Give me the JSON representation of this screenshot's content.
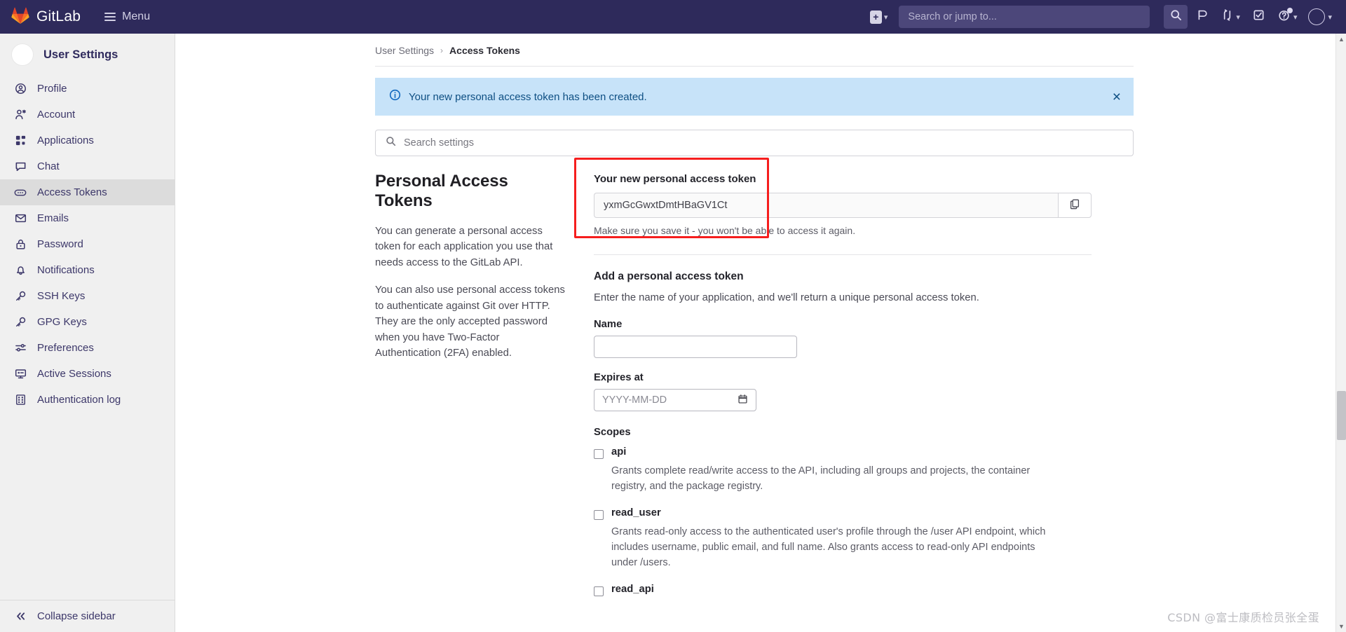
{
  "topnav": {
    "brand": "GitLab",
    "menu_label": "Menu",
    "new_icon": "plus-square-icon",
    "search_placeholder": "Search or jump to...",
    "icons": [
      {
        "name": "search-icon",
        "label": ""
      },
      {
        "name": "issues-icon",
        "label": ""
      },
      {
        "name": "merge-requests-icon",
        "label": ""
      },
      {
        "name": "todos-icon",
        "label": ""
      },
      {
        "name": "help-icon",
        "label": ""
      },
      {
        "name": "user-avatar-icon",
        "label": ""
      }
    ]
  },
  "sidebar": {
    "title": "User Settings",
    "items": [
      {
        "label": "Profile",
        "icon": "profile-icon",
        "active": false
      },
      {
        "label": "Account",
        "icon": "account-icon",
        "active": false
      },
      {
        "label": "Applications",
        "icon": "applications-icon",
        "active": false
      },
      {
        "label": "Chat",
        "icon": "chat-icon",
        "active": false
      },
      {
        "label": "Access Tokens",
        "icon": "token-icon",
        "active": true
      },
      {
        "label": "Emails",
        "icon": "email-icon",
        "active": false
      },
      {
        "label": "Password",
        "icon": "lock-icon",
        "active": false
      },
      {
        "label": "Notifications",
        "icon": "bell-icon",
        "active": false
      },
      {
        "label": "SSH Keys",
        "icon": "key-icon",
        "active": false
      },
      {
        "label": "GPG Keys",
        "icon": "key-icon",
        "active": false
      },
      {
        "label": "Preferences",
        "icon": "sliders-icon",
        "active": false
      },
      {
        "label": "Active Sessions",
        "icon": "monitor-icon",
        "active": false
      },
      {
        "label": "Authentication log",
        "icon": "log-icon",
        "active": false
      }
    ],
    "collapse_label": "Collapse sidebar",
    "collapse_icon": "chevron-double-left-icon"
  },
  "breadcrumb": {
    "parent": "User Settings",
    "separator": "›",
    "current": "Access Tokens"
  },
  "alert": {
    "icon": "info-circle-icon",
    "message": "Your new personal access token has been created.",
    "close_icon": "close-icon",
    "close_glyph": "×",
    "background": "#c7e3f9",
    "text_color": "#0e4f83"
  },
  "settings_search": {
    "icon": "search-icon",
    "placeholder": "Search settings"
  },
  "main": {
    "heading": "Personal Access Tokens",
    "paragraphs": [
      "You can generate a personal access token for each application you use that needs access to the GitLab API.",
      "You can also use personal access tokens to authenticate against Git over HTTP. They are the only accepted password when you have Two-Factor Authentication (2FA) enabled."
    ],
    "token_panel": {
      "label": "Your new personal access token",
      "value": "yxmGcGwxtDmtHBaGV1Ct",
      "copy_icon": "copy-icon",
      "hint": "Make sure you save it - you won't be able to access it again.",
      "highlight_color": "#f61e1e"
    },
    "add_section": {
      "title": "Add a personal access token",
      "description": "Enter the name of your application, and we'll return a unique personal access token.",
      "name_label": "Name",
      "name_value": "",
      "name_placeholder": "",
      "expires_label": "Expires at",
      "expires_value": "",
      "expires_placeholder": "YYYY-MM-DD",
      "calendar_icon": "calendar-icon"
    },
    "scopes": {
      "title": "Scopes",
      "items": [
        {
          "name": "api",
          "checked": false,
          "description": "Grants complete read/write access to the API, including all groups and projects, the container registry, and the package registry."
        },
        {
          "name": "read_user",
          "checked": false,
          "description": "Grants read-only access to the authenticated user's profile through the /user API endpoint, which includes username, public email, and full name. Also grants access to read-only API endpoints under /users."
        },
        {
          "name": "read_api",
          "checked": false,
          "description": ""
        }
      ]
    }
  },
  "watermark": "CSDN @富士康质检员张全蛋",
  "scrollbar": {
    "up_glyph": "▲",
    "down_glyph": "▼"
  }
}
